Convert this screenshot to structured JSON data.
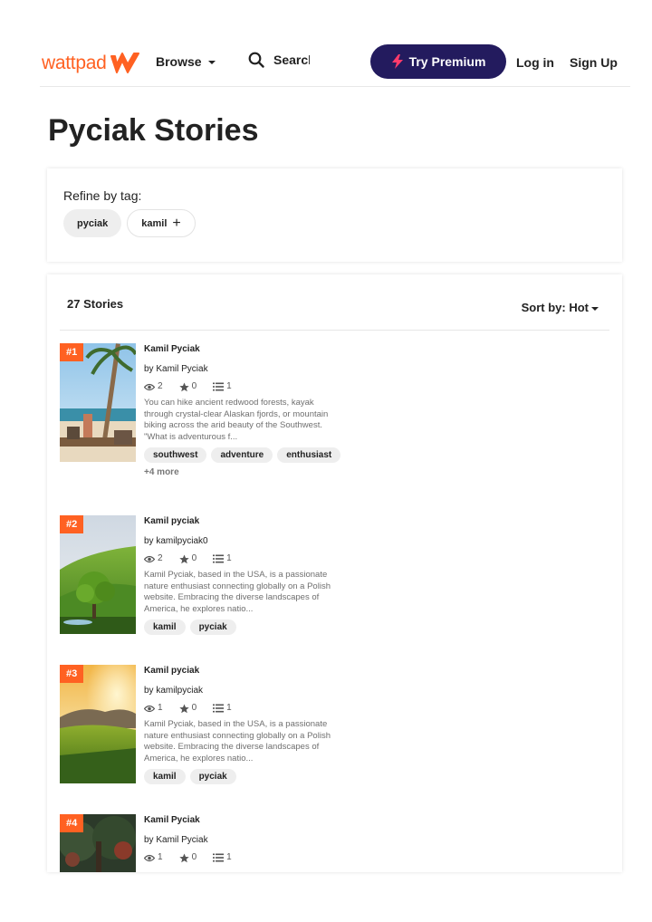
{
  "header": {
    "logo_text": "wattpad",
    "browse_label": "Browse",
    "search_placeholder": "Search",
    "premium_label": "Try Premium",
    "login_label": "Log in",
    "signup_label": "Sign Up",
    "brand_color": "#ff6122",
    "premium_bg": "#231b5e"
  },
  "page": {
    "title": "Pyciak Stories"
  },
  "refine": {
    "label": "Refine by tag:",
    "tags": [
      {
        "label": "pyciak",
        "active": true
      },
      {
        "label": "kamil",
        "active": false,
        "icon": "plus-icon"
      }
    ]
  },
  "stories_panel": {
    "count_label": "27 Stories",
    "sort_label": "Sort by: Hot"
  },
  "stories": [
    {
      "rank": "#1",
      "title": "Kamil Pyciak",
      "author": "by Kamil Pyciak",
      "views": "2",
      "votes": "0",
      "parts": "1",
      "description": "You can hike ancient redwood forests, kayak through crystal-clear Alaskan fjords, or mountain biking across the arid beauty of the Southwest. \"What is adventurous f...",
      "tags": [
        "southwest",
        "adventure",
        "enthusiast"
      ],
      "more": "+4 more"
    },
    {
      "rank": "#2",
      "title": "Kamil pyciak",
      "author": "by kamilpyciak0",
      "views": "2",
      "votes": "0",
      "parts": "1",
      "description": "Kamil Pyciak, based in the USA, is a passionate nature enthusiast connecting globally on a Polish website. Embracing the diverse landscapes of America, he explores natio...",
      "tags": [
        "kamil",
        "pyciak"
      ]
    },
    {
      "rank": "#3",
      "title": "Kamil pyciak",
      "author": "by kamilpyciak",
      "views": "1",
      "votes": "0",
      "parts": "1",
      "description": "Kamil Pyciak, based in the USA, is a passionate nature enthusiast connecting globally on a Polish website. Embracing the diverse landscapes of America, he explores natio...",
      "tags": [
        "kamil",
        "pyciak"
      ]
    },
    {
      "rank": "#4",
      "title": "Kamil Pyciak",
      "author": "by Kamil Pyciak",
      "views": "1",
      "votes": "0",
      "parts": "1"
    }
  ]
}
